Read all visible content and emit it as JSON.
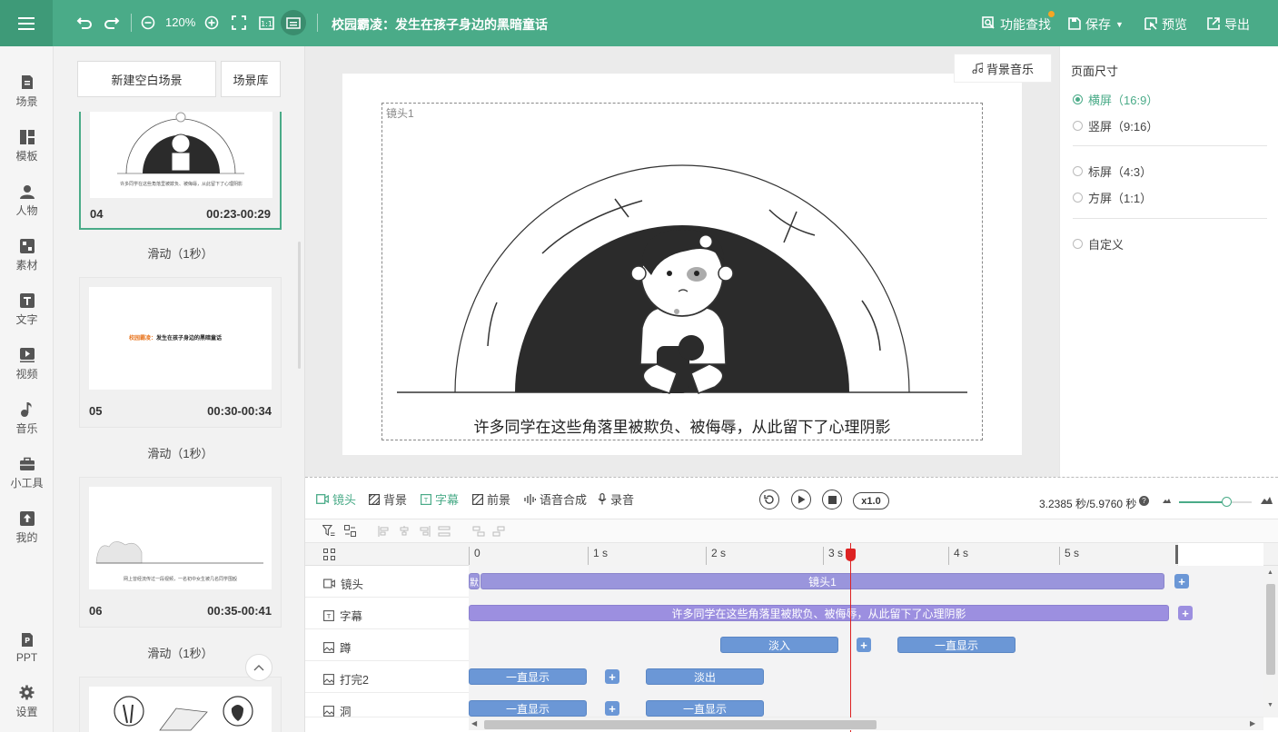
{
  "topbar": {
    "zoom": "120%",
    "title": "校园霸凌：发生在孩子身边的黑暗童话",
    "find_label": "功能查找",
    "save_label": "保存",
    "preview_label": "预览",
    "export_label": "导出"
  },
  "nav": [
    {
      "label": "场景",
      "icon": "scene-icon"
    },
    {
      "label": "模板",
      "icon": "template-icon"
    },
    {
      "label": "人物",
      "icon": "person-icon"
    },
    {
      "label": "素材",
      "icon": "material-icon"
    },
    {
      "label": "文字",
      "icon": "text-icon"
    },
    {
      "label": "视频",
      "icon": "video-icon"
    },
    {
      "label": "音乐",
      "icon": "music-icon"
    },
    {
      "label": "小工具",
      "icon": "toolbox-icon"
    },
    {
      "label": "我的",
      "icon": "upload-icon"
    },
    {
      "label": "PPT",
      "icon": "ppt-icon"
    },
    {
      "label": "设置",
      "icon": "gear-icon"
    }
  ],
  "scenes_panel": {
    "new_blank_label": "新建空白场景",
    "library_label": "场景库",
    "scenes": [
      {
        "num": "04",
        "time": "00:23-00:29",
        "transition": "滑动（1秒）",
        "thumb_caption": "许多同学在这些角落里被欺负、被侮辱，从此留下了心理阴影"
      },
      {
        "num": "05",
        "time": "00:30-00:34",
        "transition": "滑动（1秒）",
        "thumb_caption_orange": "校园霸凌：",
        "thumb_caption_dark": "发生在孩子身边的黑暗童话"
      },
      {
        "num": "06",
        "time": "00:35-00:41",
        "transition": "滑动（1秒）",
        "thumb_caption": "网上曾经流传过一段视频，一名初中女生被几名同学围殴"
      }
    ]
  },
  "canvas": {
    "bgm_label": "背景音乐",
    "lens_label": "镜头1",
    "subtitle": "许多同学在这些角落里被欺负、被侮辱，从此留下了心理阴影"
  },
  "page_size": {
    "title": "页面尺寸",
    "options": [
      {
        "label": "横屏（16:9）",
        "selected": true
      },
      {
        "label": "竖屏（9:16）",
        "selected": false
      },
      {
        "label": "标屏（4:3）",
        "selected": false
      },
      {
        "label": "方屏（1:1）",
        "selected": false
      },
      {
        "label": "自定义",
        "selected": false
      }
    ]
  },
  "timeline": {
    "tabs": [
      "镜头",
      "背景",
      "字幕",
      "前景",
      "语音合成",
      "录音"
    ],
    "speed": "x1.0",
    "time_info": "3.2385 秒/5.9760 秒",
    "ruler": [
      "0",
      "1 s",
      "2 s",
      "3 s",
      "4 s",
      "5 s"
    ],
    "tracks": [
      {
        "label": "镜头",
        "clips": [
          {
            "text": "默"
          },
          {
            "text": "镜头1"
          }
        ]
      },
      {
        "label": "字幕",
        "clips": [
          {
            "text": "许多同学在这些角落里被欺负、被侮辱，从此留下了心理阴影"
          }
        ]
      },
      {
        "label": "蹲",
        "clips": [
          {
            "text": "淡入"
          },
          {
            "text": "一直显示"
          }
        ]
      },
      {
        "label": "打完2",
        "clips": [
          {
            "text": "一直显示"
          },
          {
            "text": "淡出"
          }
        ]
      },
      {
        "label": "洞",
        "clips": [
          {
            "text": "一直显示"
          },
          {
            "text": "一直显示"
          }
        ]
      }
    ]
  },
  "colors": {
    "brand": "#4aab88",
    "clip_blue": "#6b97d6",
    "clip_purple": "#9a95dc",
    "playhead": "#dd2222"
  }
}
